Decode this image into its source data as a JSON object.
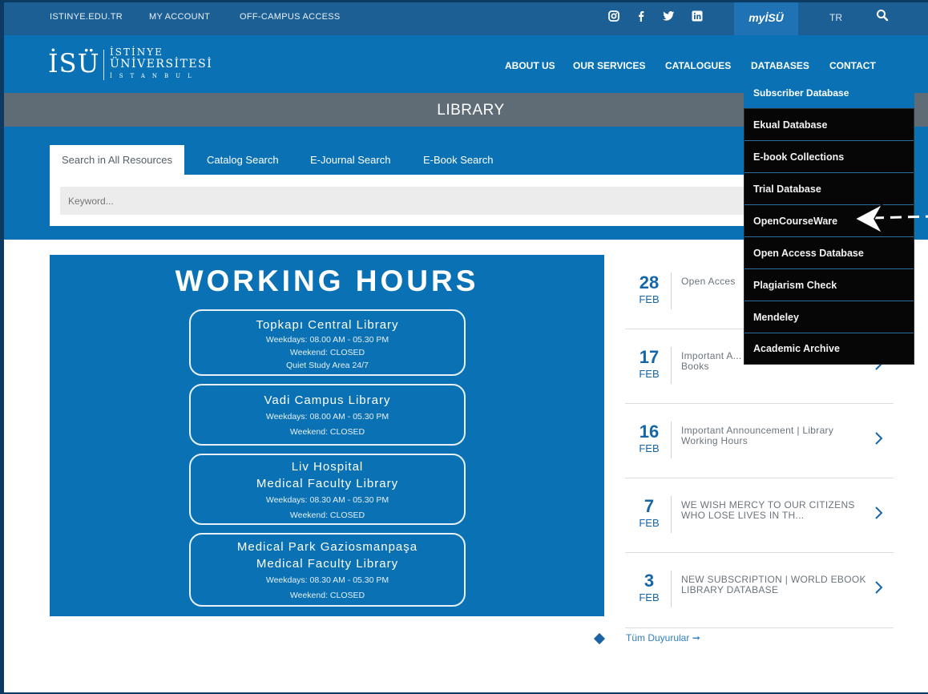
{
  "topbar": {
    "links": [
      "ISTINYE.EDU.TR",
      "MY ACCOUNT",
      "OFF-CAMPUS ACCESS"
    ],
    "social_icons": [
      "instagram-icon",
      "facebook-icon",
      "twitter-icon",
      "linkedin-icon"
    ],
    "myisu": "myİSÜ",
    "lang": "TR",
    "search_icon": "search-icon"
  },
  "logo": {
    "abbr": "İSÜ",
    "line1": "İSTİNYE",
    "line2": "ÜNİVERSİTESİ",
    "line3": "İSTANBUL"
  },
  "nav": [
    "ABOUT US",
    "OUR SERVICES",
    "CATALOGUES",
    "DATABASES",
    "CONTACT"
  ],
  "page_title": "LIBRARY",
  "search": {
    "tabs": [
      "Search in All Resources",
      "Catalog Search",
      "E-Journal Search",
      "E-Book Search"
    ],
    "placeholder": "Keyword..."
  },
  "hours": {
    "title": "WORKING HOURS",
    "libraries": [
      {
        "name": [
          "Topkapı Central Library"
        ],
        "info": [
          "Weekdays: 08.00 AM - 05.30 PM",
          "Weekend: CLOSED",
          "Quiet Study Area 24/7"
        ]
      },
      {
        "name": [
          "Vadi Campus Library"
        ],
        "info": [
          "Weekdays: 08.00 AM - 05.30 PM",
          "Weekend: CLOSED"
        ]
      },
      {
        "name": [
          "Liv Hospital",
          "Medical Faculty Library"
        ],
        "info": [
          "Weekdays: 08.30 AM - 05.30 PM",
          "Weekend: CLOSED"
        ]
      },
      {
        "name": [
          "Medical Park Gaziosmanpaşa",
          "Medical Faculty Library"
        ],
        "info": [
          "Weekdays: 08.30 AM - 05.30 PM",
          "Weekend: CLOSED"
        ]
      }
    ]
  },
  "news": [
    {
      "day": "28",
      "month": "FEB",
      "text": "Open Acces"
    },
    {
      "day": "17",
      "month": "FEB",
      "text": "Important A... Date of the Borrowed Books"
    },
    {
      "day": "16",
      "month": "FEB",
      "text": "Important Announcement | Library Working Hours"
    },
    {
      "day": "7",
      "month": "FEB",
      "text": "WE WISH MERCY TO OUR CITIZENS WHO LOSE LIVES IN TH..."
    },
    {
      "day": "3",
      "month": "FEB",
      "text": "NEW SUBSCRIPTION | WORLD EBOOK LIBRARY DATABASE"
    }
  ],
  "all_announcements": "Tüm Duyurular ➞",
  "databases_menu": {
    "header": "Subscriber Database",
    "items": [
      "Ekual Database",
      "E-book Collections",
      "Trial Database",
      "OpenCourseWare",
      "Open Access Database",
      "Plagiarism Check",
      "Mendeley",
      "Academic Archive"
    ]
  },
  "colors": {
    "brand_blue": "#0a72b4",
    "topbar": "#1c5f94",
    "band_gray": "#5f6b75",
    "menu_black": "#060606"
  }
}
